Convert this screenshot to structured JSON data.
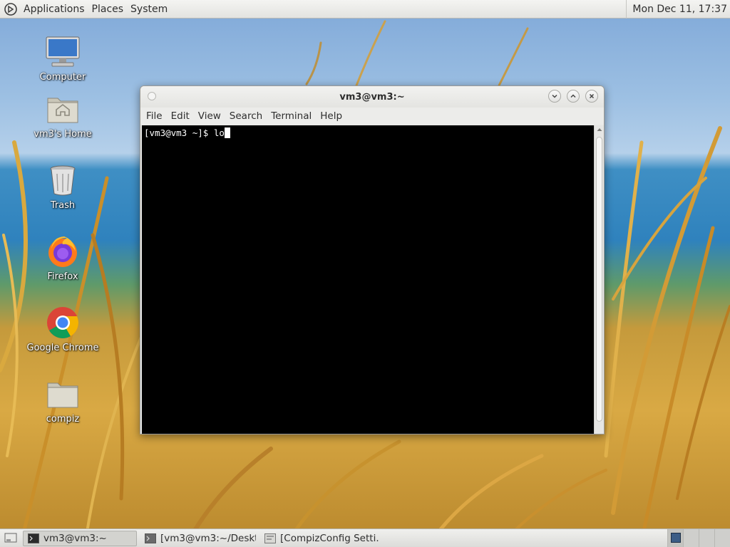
{
  "top_panel": {
    "menus": [
      "Applications",
      "Places",
      "System"
    ],
    "clock": "Mon Dec 11, 17:37"
  },
  "desktop_icons": [
    {
      "label": "Computer",
      "icon": "computer-icon"
    },
    {
      "label": "vm3's Home",
      "icon": "home-folder-icon"
    },
    {
      "label": "Trash",
      "icon": "trash-icon"
    },
    {
      "label": "Firefox",
      "icon": "firefox-icon"
    },
    {
      "label": "Google Chrome",
      "icon": "chrome-icon"
    },
    {
      "label": "compiz",
      "icon": "folder-icon"
    }
  ],
  "terminal": {
    "title": "vm3@vm3:~",
    "menus": [
      "File",
      "Edit",
      "View",
      "Search",
      "Terminal",
      "Help"
    ],
    "prompt": "[vm3@vm3 ~]$ ",
    "input": "lo"
  },
  "taskbar": {
    "tasks": [
      {
        "label": "vm3@vm3:~",
        "active": true
      },
      {
        "label": "[vm3@vm3:~/Deskt...",
        "active": false
      },
      {
        "label": "[CompizConfig Setti...",
        "active": false
      }
    ]
  },
  "colors": {
    "terminal_bg": "#000000",
    "terminal_fg": "#ffffff",
    "panel_bg": "#ececea"
  }
}
